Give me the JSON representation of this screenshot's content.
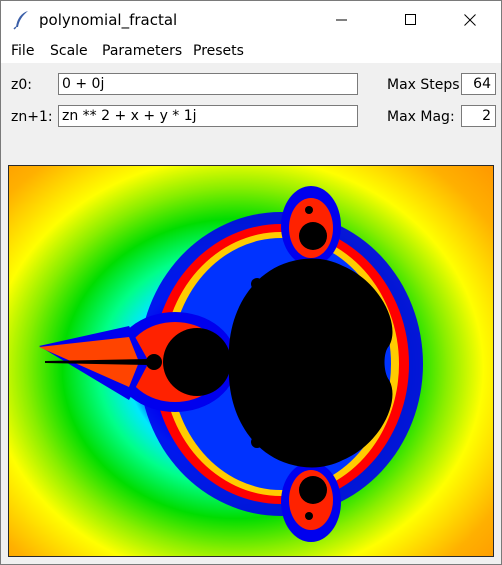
{
  "window": {
    "title": "polynomial_fractal",
    "icon": "feather-icon"
  },
  "menu": [
    "File",
    "Scale",
    "Parameters",
    "Presets"
  ],
  "params": {
    "z0_label": "z0:",
    "z0_value": "0 + 0j",
    "zn_label": "zn+1:",
    "zn_value": "zn ** 2 + x + y * 1j",
    "max_steps_label": "Max Steps:",
    "max_steps_value": "64",
    "max_mag_label": "Max Mag:",
    "max_mag_value": "2"
  },
  "colors": {
    "set": "#000000",
    "outer": "#ff9000",
    "mid": "#00dd00",
    "inner": "#0000ff"
  }
}
